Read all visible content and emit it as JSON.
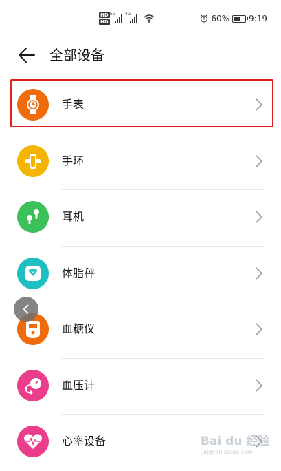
{
  "status_bar": {
    "hd1": "HD",
    "hd2": "HD",
    "net1": "5G",
    "net2": "4G",
    "alarm_icon": "alarm-icon",
    "battery": "60%",
    "time": "9:19"
  },
  "header": {
    "back_icon": "arrow-left-icon",
    "title": "全部设备"
  },
  "devices": [
    {
      "label": "手表",
      "icon": "watch-icon",
      "color": "#ef6b0c"
    },
    {
      "label": "手环",
      "icon": "band-icon",
      "color": "#f5b400"
    },
    {
      "label": "耳机",
      "icon": "earphone-icon",
      "color": "#3cc15a"
    },
    {
      "label": "体脂秤",
      "icon": "scale-icon",
      "color": "#1ebfc2"
    },
    {
      "label": "血糖仪",
      "icon": "glucose-meter-icon",
      "color": "#ef6b0c"
    },
    {
      "label": "血压计",
      "icon": "blood-pressure-icon",
      "color": "#ec3c8c"
    },
    {
      "label": "心率设备",
      "icon": "heart-rate-icon",
      "color": "#ec3c8c"
    }
  ],
  "highlight_color": "#e02020",
  "watermark": {
    "text": "Bai du 经验",
    "sub": "jingyan.baidu.com"
  }
}
